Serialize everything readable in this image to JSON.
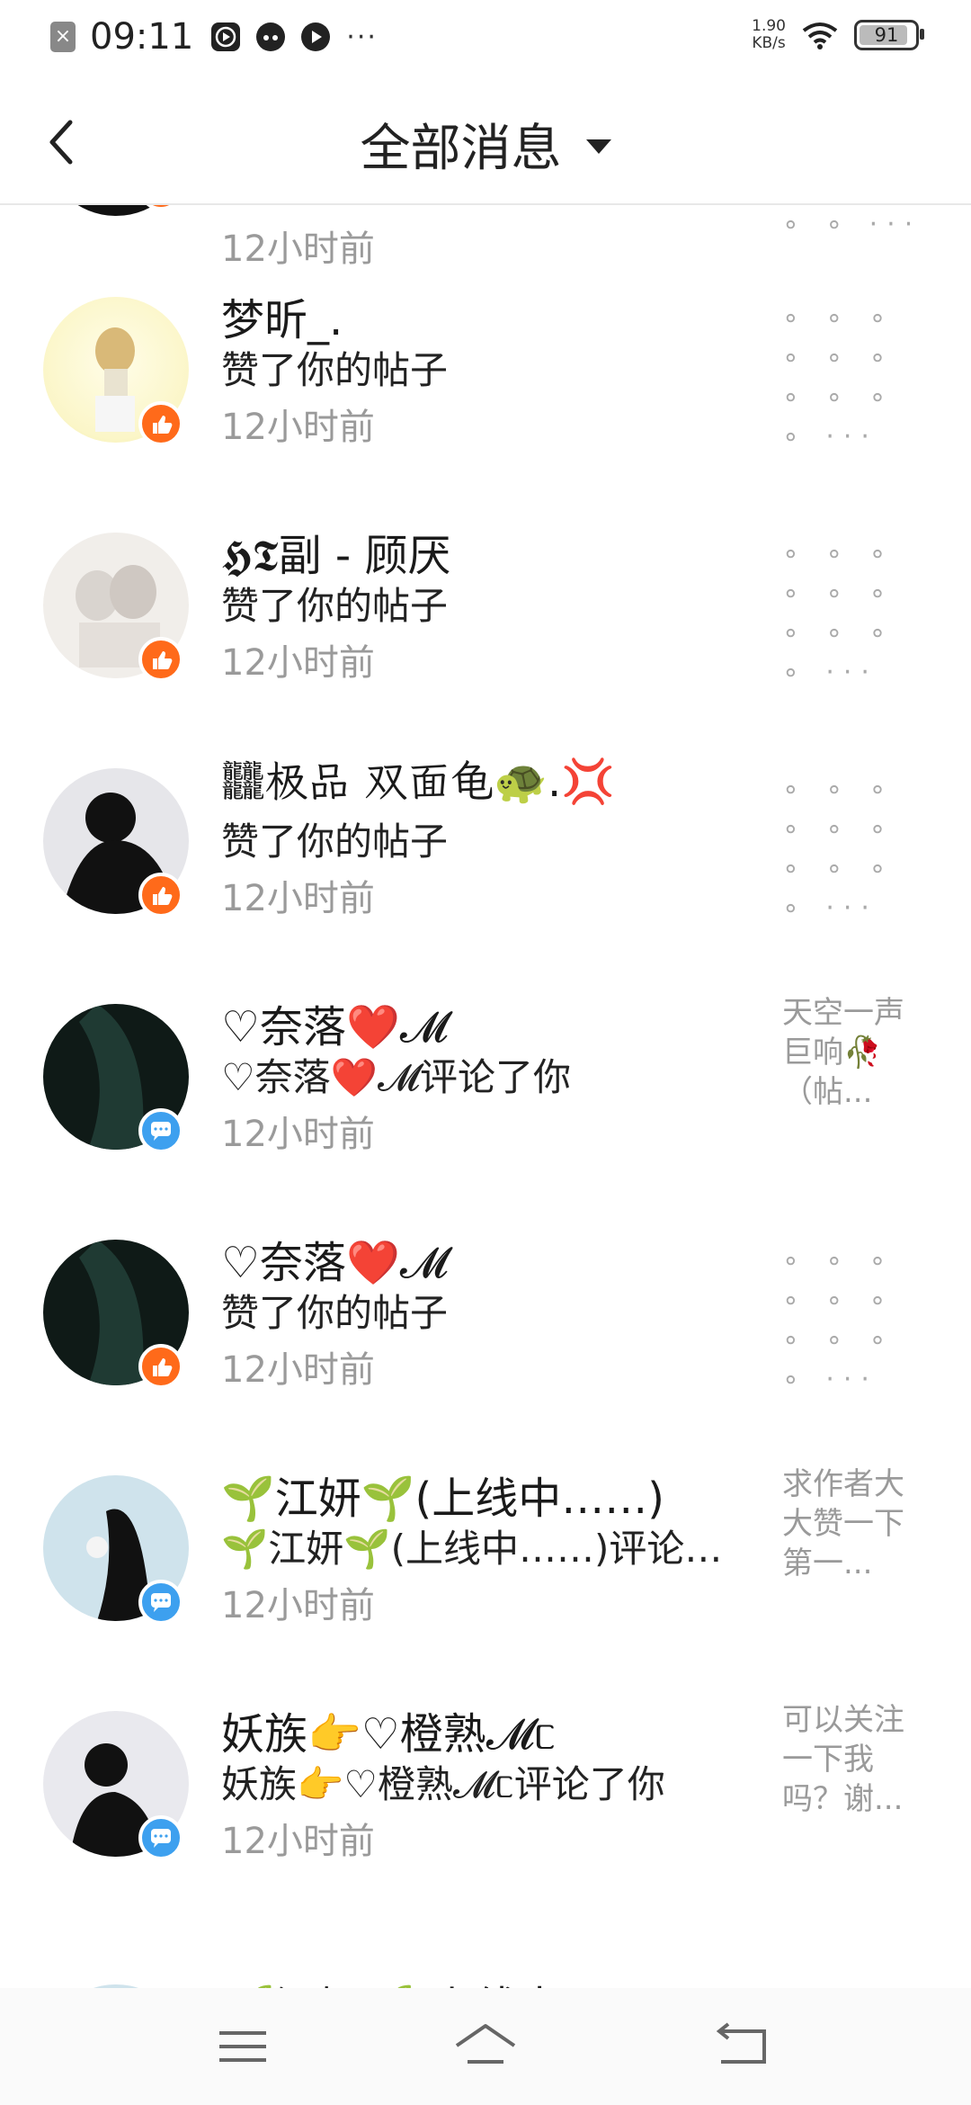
{
  "status_bar": {
    "time": "09:11",
    "speed_value": "1.90",
    "speed_unit": "KB/s",
    "battery": "91",
    "overflow": "···",
    "icons": [
      "close-icon",
      "play-icon",
      "cat-icon",
      "pause-icon",
      "wifi-icon",
      "battery-icon"
    ]
  },
  "header": {
    "title": "全部消息",
    "back_icon": "back-arrow-icon",
    "dropdown_icon": "triangle-down-icon"
  },
  "messages": [
    {
      "name": "",
      "action": "",
      "time": "12小时前",
      "preview": "∘ ∘ ···",
      "type": "like"
    },
    {
      "name": "梦昕_.",
      "action": "赞了你的帖子",
      "time": "12小时前",
      "preview": "∘ ∘ ∘ ∘ ∘ ∘ ∘ ∘ ∘ ∘ ···",
      "type": "like"
    },
    {
      "name": "𝕳𝕿副 - 顾厌",
      "action": "赞了你的帖子",
      "time": "12小时前",
      "preview": "∘ ∘ ∘ ∘ ∘ ∘ ∘ ∘ ∘ ∘ ···",
      "type": "like"
    },
    {
      "name": "𪚥极品 双面龟🐢.💢",
      "action": "赞了你的帖子",
      "time": "12小时前",
      "preview": "∘ ∘ ∘ ∘ ∘ ∘ ∘ ∘ ∘ ∘ ···",
      "type": "like"
    },
    {
      "name": "♡奈落❤️𝓜",
      "action": "♡奈落❤️𝓜评论了你",
      "time": "12小时前",
      "preview": "天空一声巨响🥀（帖...",
      "type": "comment"
    },
    {
      "name": "♡奈落❤️𝓜",
      "action": "赞了你的帖子",
      "time": "12小时前",
      "preview": "∘ ∘ ∘ ∘ ∘ ∘ ∘ ∘ ∘ ∘ ···",
      "type": "like"
    },
    {
      "name": "🌱江妍🌱(上线中……)",
      "action": "🌱江妍🌱(上线中……)评论…",
      "time": "12小时前",
      "preview": "求作者大大赞一下第一...",
      "type": "comment"
    },
    {
      "name": "妖族👉♡橙熟𝓜ᥴ",
      "action": "妖族👉♡橙熟𝓜ᥴ评论了你",
      "time": "12小时前",
      "preview": "可以关注一下我吗？谢...",
      "type": "comment"
    },
    {
      "name": "🌱江妍🌱(上线中……)",
      "action": "",
      "time": "",
      "preview": "",
      "type": "comment"
    }
  ],
  "nav_bar": {
    "icons": [
      "menu-icon",
      "home-icon",
      "back-icon"
    ]
  }
}
